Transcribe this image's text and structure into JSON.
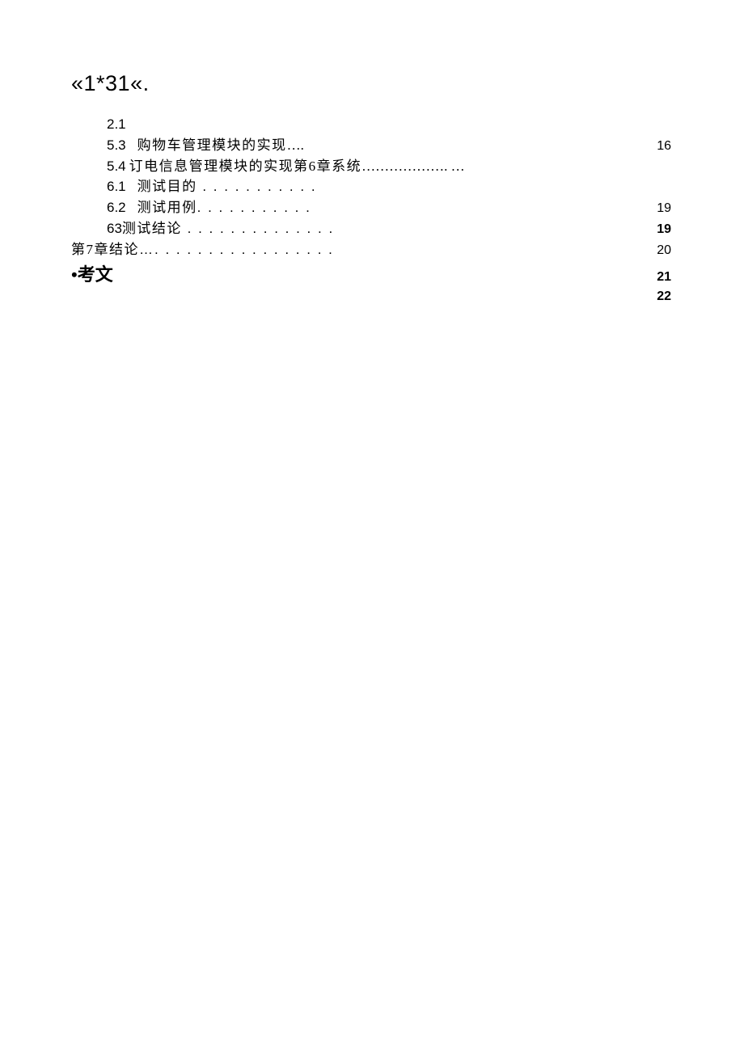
{
  "heading": "«1*31«.",
  "toc": {
    "rows": [
      {
        "indent": "indent1",
        "num": "2.1",
        "gap": "gap",
        "title": "",
        "dots": "",
        "page": "",
        "bold_page": false
      },
      {
        "indent": "indent1",
        "num": "5.3",
        "gap": "gap",
        "title": "购物车管理模块的实现",
        "dots": "….",
        "page": "16",
        "bold_page": false
      },
      {
        "indent": "indent1",
        "num": "5.4",
        "gap": "gap-sm",
        "title": "订电信息管理模块的实现第6章系统",
        "dots": "………………. …",
        "page": "",
        "bold_page": false
      },
      {
        "indent": "indent1",
        "num": "6.1",
        "gap": "gap",
        "title": "测试目的",
        "dots": " . . . . . . . . . . .",
        "page": "",
        "bold_page": false
      },
      {
        "indent": "indent1",
        "num": "6.2",
        "gap": "gap",
        "title": "测试用例",
        "dots": ". . . . . . . . . . .",
        "page": "19",
        "bold_page": false
      },
      {
        "indent": "indent1",
        "num": "63",
        "gap": "",
        "title": "测试结论",
        "dots": " . . . . . . . . . . . . . .",
        "page": "19",
        "bold_page": true
      },
      {
        "indent": "indent0",
        "num": "",
        "gap": "",
        "title": "第7章结论",
        "dots": "…. . . . . . . . . . . . . . . . .",
        "page": "20",
        "bold_page": false
      }
    ],
    "trailing_pages": [
      "21",
      "22"
    ]
  },
  "kaowen": "•考文"
}
